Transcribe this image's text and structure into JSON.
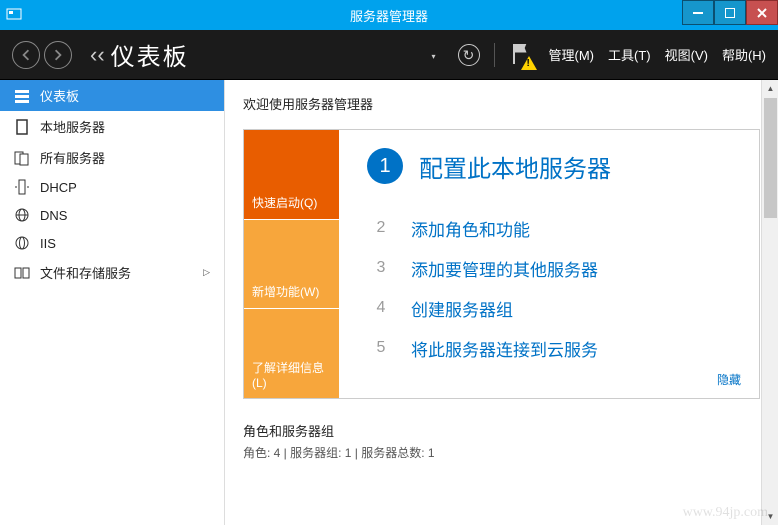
{
  "window": {
    "title": "服务器管理器"
  },
  "toolbar": {
    "page_title": "仪表板",
    "menu": {
      "manage": "管理(M)",
      "tools": "工具(T)",
      "view": "视图(V)",
      "help": "帮助(H)"
    }
  },
  "sidebar": {
    "items": [
      {
        "label": "仪表板"
      },
      {
        "label": "本地服务器"
      },
      {
        "label": "所有服务器"
      },
      {
        "label": "DHCP"
      },
      {
        "label": "DNS"
      },
      {
        "label": "IIS"
      },
      {
        "label": "文件和存储服务"
      }
    ]
  },
  "main": {
    "welcome": "欢迎使用服务器管理器",
    "tabs": {
      "quickstart": "快速启动(Q)",
      "whatsnew": "新增功能(W)",
      "learnmore": "了解详细信息(L)"
    },
    "steps": [
      {
        "num": "1",
        "text": "配置此本地服务器"
      },
      {
        "num": "2",
        "text": "添加角色和功能"
      },
      {
        "num": "3",
        "text": "添加要管理的其他服务器"
      },
      {
        "num": "4",
        "text": "创建服务器组"
      },
      {
        "num": "5",
        "text": "将此服务器连接到云服务"
      }
    ],
    "hide": "隐藏",
    "roles_header": "角色和服务器组",
    "roles_summary": "角色: 4 | 服务器组: 1 | 服务器总数: 1"
  },
  "watermark": "www.94jp.com"
}
